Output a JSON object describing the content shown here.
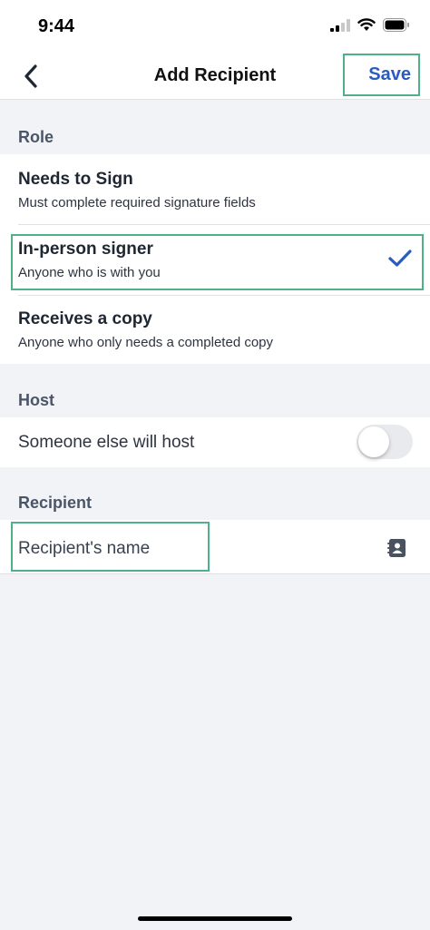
{
  "status": {
    "time": "9:44"
  },
  "nav": {
    "title": "Add Recipient",
    "save_label": "Save"
  },
  "role": {
    "header": "Role",
    "options": [
      {
        "title": "Needs to Sign",
        "subtitle": "Must complete required signature fields",
        "selected": false
      },
      {
        "title": "In-person signer",
        "subtitle": "Anyone who is with you",
        "selected": true
      },
      {
        "title": "Receives a copy",
        "subtitle": "Anyone who only needs a completed copy",
        "selected": false
      }
    ]
  },
  "host": {
    "header": "Host",
    "toggle_label": "Someone else will host",
    "toggle_on": false
  },
  "recipient": {
    "header": "Recipient",
    "name_placeholder": "Recipient's name",
    "name_value": ""
  },
  "colors": {
    "accent": "#2a5bc2",
    "highlight": "#4fb08a",
    "background": "#f2f3f6"
  },
  "icons": {
    "back": "chevron-left-icon",
    "check": "checkmark-icon",
    "contacts": "contact-book-icon"
  }
}
